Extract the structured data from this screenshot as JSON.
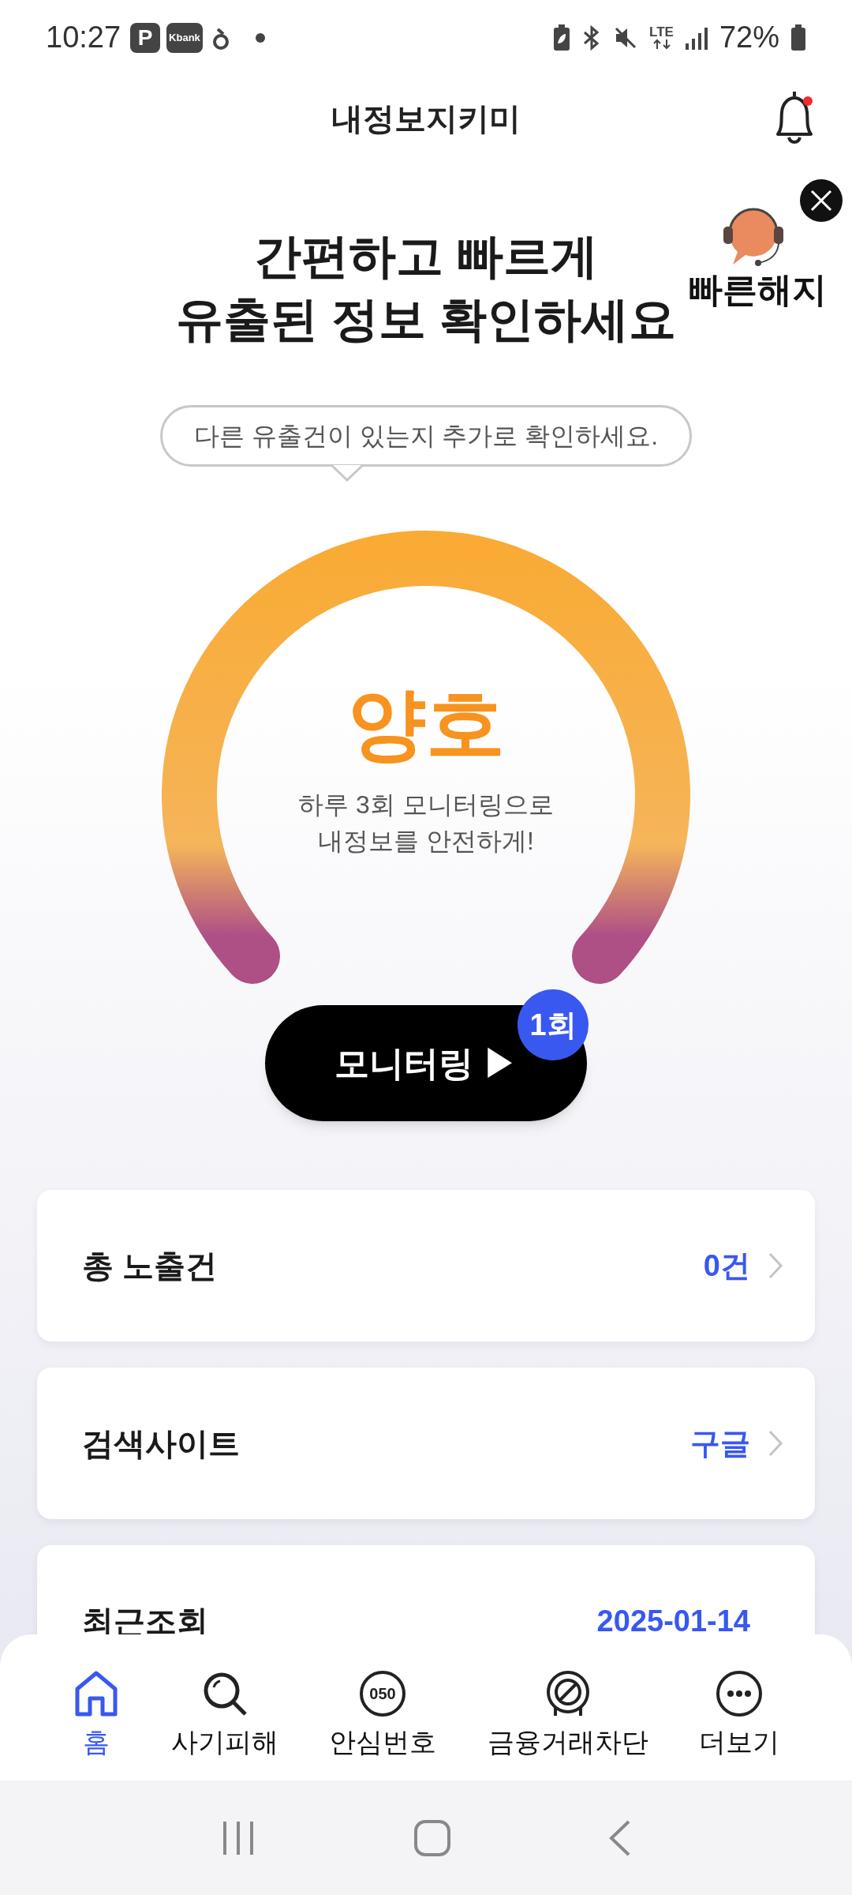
{
  "status_bar": {
    "time": "10:27",
    "app_icons": [
      "P",
      "Kbank"
    ],
    "network": "LTE",
    "battery": "72%"
  },
  "header": {
    "title": "내정보지키미",
    "unread": true
  },
  "headline": [
    "간편하고 빠르게",
    "유출된 정보 확인하세요"
  ],
  "quick_cancel": {
    "label": "빠른해지"
  },
  "tooltip": "다른 유출건이 있는지 추가로 확인하세요.",
  "gauge": {
    "status": "양호",
    "caption": [
      "하루 3회 모니터링으로",
      "내정보를 안전하게!"
    ]
  },
  "monitor_button": {
    "label": "모니터링 ▶",
    "badge": "1회"
  },
  "cards": [
    {
      "label": "총 노출건",
      "value": "0건",
      "chevron": true
    },
    {
      "label": "검색사이트",
      "value": "구글",
      "chevron": true
    },
    {
      "label": "최근조회",
      "value": "2025-01-14",
      "chevron": false
    }
  ],
  "nav": [
    {
      "label": "홈",
      "kind": "home",
      "selected": true
    },
    {
      "label": "사기피해",
      "kind": "search",
      "selected": false
    },
    {
      "label": "안심번호",
      "kind": "number",
      "icon_text": "050",
      "selected": false
    },
    {
      "label": "금융거래차단",
      "kind": "block",
      "selected": false
    },
    {
      "label": "더보기",
      "kind": "more",
      "selected": false
    }
  ]
}
